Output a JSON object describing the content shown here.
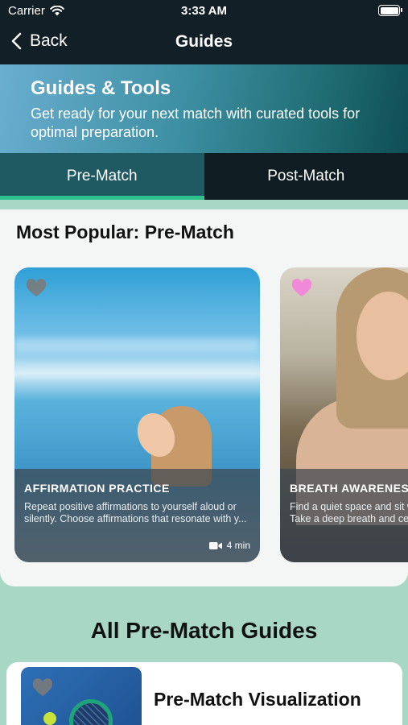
{
  "status_bar": {
    "carrier": "Carrier",
    "time": "3:33 AM"
  },
  "nav": {
    "back_label": "Back",
    "title": "Guides"
  },
  "hero": {
    "title": "Guides & Tools",
    "subtitle": "Get ready for your next match with curated tools for optimal preparation."
  },
  "tabs": [
    {
      "label": "Pre-Match",
      "active": true
    },
    {
      "label": "Post-Match",
      "active": false
    }
  ],
  "popular": {
    "heading": "Most Popular: Pre-Match",
    "cards": [
      {
        "title": "AFFIRMATION PRACTICE",
        "description": "Repeat positive affirmations to yourself aloud or silently. Choose affirmations that resonate with y...",
        "duration": "4 min",
        "favorite": false
      },
      {
        "title": "BREATH AWARENESS",
        "description": "Find a quiet space and sit with your eyes closed. Take a deep breath and center your...",
        "favorite": true
      }
    ]
  },
  "all_guides": {
    "heading": "All Pre-Match Guides",
    "items": [
      {
        "title": "Pre-Match Visualization",
        "favorite": false
      }
    ]
  },
  "colors": {
    "header_bg": "#121f26",
    "tab_active_bg": "#1f5a63",
    "tab_indicator": "#2fc28c",
    "page_bg": "#a9d7c6",
    "heart_favorite": "#f08ad8",
    "heart_default": "#7a7a7a"
  }
}
